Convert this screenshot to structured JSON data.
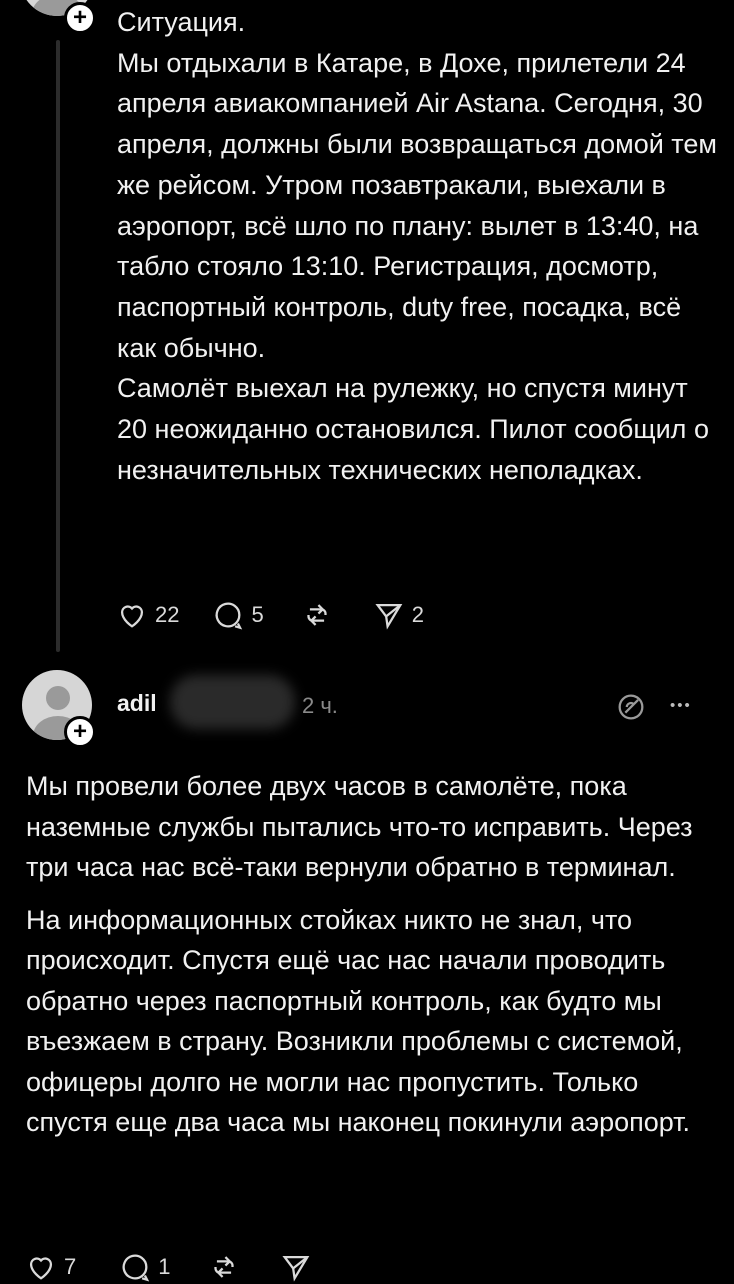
{
  "post": {
    "paragraphs": [
      "Ситуация.\nМы отдыхали в Катаре, в Дохе, прилетели 24 апреля авиакомпанией Air Astana. Сегодня, 30 апреля, должны были возвращаться домой тем же рейсом. Утром позавтракали, выехали в аэропорт, всё шло по плану: вылет в 13:40, на табло стояло 13:10. Регистрация, досмотр, паспортный контроль, duty free, посадка, всё как обычно.",
      "Самолёт выехал на рулежку, но спустя минут 20 неожиданно остановился. Пилот сообщил о незначительных технических неполадках."
    ],
    "likes": "22",
    "comments": "5",
    "shares": "2"
  },
  "reply": {
    "username": "adil",
    "time": "2 ч.",
    "paragraphs": [
      "Мы провели более двух часов в самолёте, пока наземные службы пытались что-то исправить. Через три часа нас всё-таки вернули обратно в терминал.",
      "На информационных стойках никто не знал, что происходит. Спустя ещё час нас начали проводить обратно через паспортный контроль, как будто мы въезжаем в страну. Возникли проблемы с системой, офицеры долго не могли нас пропустить. Только спустя еще два часа мы наконец покинули аэропорт."
    ],
    "likes": "7",
    "comments": "1"
  },
  "icons": {
    "plus": "+",
    "more": "•••"
  }
}
